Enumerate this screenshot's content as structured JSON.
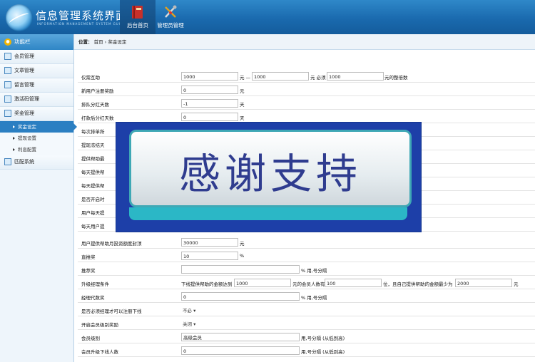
{
  "header": {
    "title": "信息管理系统界面",
    "subtitle": "INFORMATION MANAGEMENT SYSTEM GUI",
    "tabs": [
      {
        "label": "后台首页",
        "icon": "book-icon"
      },
      {
        "label": "管理员管理",
        "icon": "tools-icon"
      }
    ]
  },
  "sidebar": {
    "heading": "功能栏",
    "items": [
      {
        "label": "会员管理"
      },
      {
        "label": "文章管理"
      },
      {
        "label": "留言管理"
      },
      {
        "label": "激活码管理"
      },
      {
        "label": "奖金管理"
      }
    ],
    "subitems": [
      {
        "label": "奖金设定"
      },
      {
        "label": "提现设置"
      },
      {
        "label": "利息配置"
      }
    ],
    "last_item": {
      "label": "匹配系统"
    }
  },
  "breadcrumb": {
    "prefix": "位置：",
    "home": "首页",
    "separator": "›",
    "current": "奖金设定"
  },
  "form": {
    "rows": [
      {
        "label": "仅需互助",
        "v1": "1000",
        "t1": "元 —",
        "v2": "1000",
        "t2": "元 必须",
        "v3": "1000",
        "t3": "元的整倍数"
      },
      {
        "label": "新用户注册奖励",
        "v1": "0",
        "t1": "元"
      },
      {
        "label": "排队分红天数",
        "v1": "-1",
        "t1": "天"
      },
      {
        "label": "打款后分红天数",
        "v1": "0",
        "t1": "天"
      },
      {
        "label": "每次排单所"
      },
      {
        "label": "提现冻结天"
      },
      {
        "label": "提供帮助最"
      },
      {
        "label": "每天提供帮"
      },
      {
        "label": "每天提供帮"
      },
      {
        "label": "是否开启时"
      },
      {
        "label": "用户每天提"
      },
      {
        "label": "每天用户提"
      },
      {
        "label": "用户提供帮助月投资额度封顶",
        "v1": "30000",
        "t1": "元"
      },
      {
        "label": "直推奖",
        "v1": "10",
        "t1": "%"
      },
      {
        "label": "推荐奖",
        "v1": "",
        "t1": "% 用,号分隔"
      },
      {
        "label": "升级经理条件",
        "p1": "下线提供帮助的金额达到",
        "v1": "1000",
        "t1": "元的会员人数有",
        "v2": "100",
        "t2": "位，且自己提供帮助的金额最少为",
        "v3": "2000",
        "t3": "元"
      },
      {
        "label": "经理代数奖",
        "v1": "0",
        "t1": "% 用,号分隔"
      },
      {
        "label": "是否必须经理才可以注册下线",
        "select": "不必"
      },
      {
        "label": "开启会员级别奖励",
        "select": "关闭"
      },
      {
        "label": "会员级别",
        "v1": "高级会员",
        "t1": "用,号分隔 (从低到高)"
      },
      {
        "label": "会员升级下线人数",
        "v1": "0",
        "t1": "用,号分隔 (从低到高)"
      }
    ]
  },
  "overlay": {
    "text": "感谢支持"
  }
}
